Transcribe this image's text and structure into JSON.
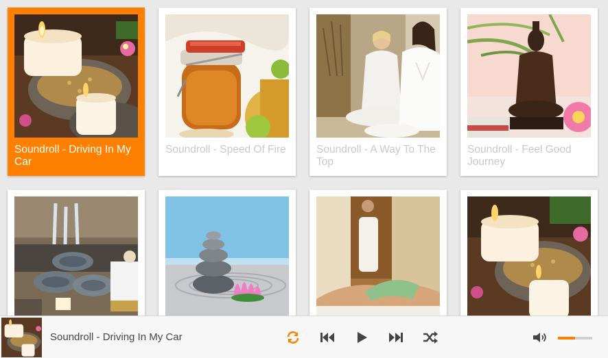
{
  "accent_color": "#ff8000",
  "tracks": [
    {
      "title": "Soundroll - Driving In My Car",
      "image": "candles-spa-icon",
      "active": true
    },
    {
      "title": "Soundroll - Speed Of Fire",
      "image": "honey-jar-icon",
      "active": false
    },
    {
      "title": "Soundroll - A Way To The Top",
      "image": "meditation-people-icon",
      "active": false
    },
    {
      "title": "Soundroll - Feel Good Journey",
      "image": "buddha-statue-icon",
      "active": false
    },
    {
      "title": "",
      "image": "towels-waterfall-icon",
      "active": false
    },
    {
      "title": "",
      "image": "zen-stones-lotus-icon",
      "active": false
    },
    {
      "title": "",
      "image": "spa-massage-icon",
      "active": false
    },
    {
      "title": "",
      "image": "candles-spa-icon",
      "active": false
    }
  ],
  "player": {
    "now_playing": "Soundroll - Driving In My Car",
    "cover_image": "candles-spa-icon",
    "volume": 0.5,
    "controls": {
      "repeat": "repeat-icon",
      "previous": "previous-icon",
      "play": "play-icon",
      "next": "next-icon",
      "shuffle": "shuffle-icon",
      "volume": "volume-icon"
    }
  }
}
